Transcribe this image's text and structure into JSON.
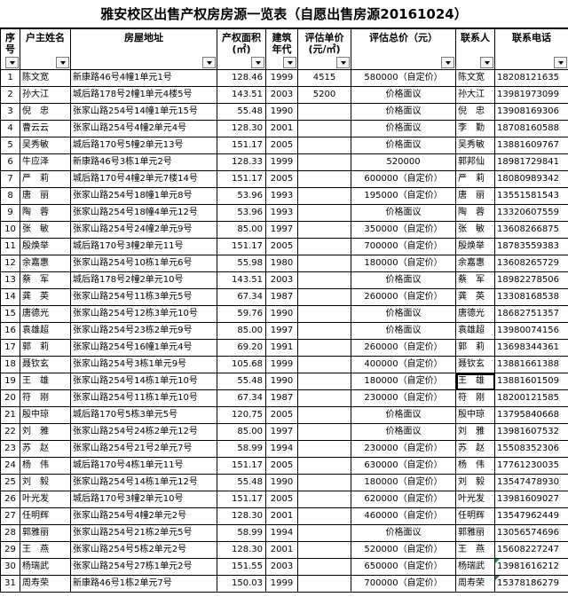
{
  "title": "雅安校区出售产权房房源一览表（自愿出售房源20161024）",
  "headers": [
    {
      "key": "seq",
      "label": "序号"
    },
    {
      "key": "owner",
      "label": "户主姓名"
    },
    {
      "key": "address",
      "label": "房屋地址"
    },
    {
      "key": "area",
      "label": "产权面积(㎡)"
    },
    {
      "key": "year",
      "label": "建筑年代"
    },
    {
      "key": "unit_price",
      "label": "评估单价(元/㎡)"
    },
    {
      "key": "total",
      "label": "评估总价（元）"
    },
    {
      "key": "contact",
      "label": "联系人"
    },
    {
      "key": "phone",
      "label": "联系电话"
    }
  ],
  "rows": [
    {
      "seq": "1",
      "owner": "陈文宽",
      "address": "新康路46号4幢1单元1号",
      "area": "128.46",
      "year": "1999",
      "unit_price": "4515",
      "total": "580000（自定价）",
      "contact": "陈文宽",
      "phone": "18208121635"
    },
    {
      "seq": "2",
      "owner": "孙大江",
      "address": "城后路178号2幢1单元4楼5号",
      "area": "143.51",
      "year": "2003",
      "unit_price": "5200",
      "total": "价格面议",
      "contact": "孙大江",
      "phone": "13981973099"
    },
    {
      "seq": "3",
      "owner": "倪　忠",
      "address": "张家山路254号14幢1单元15号",
      "area": "55.48",
      "year": "1990",
      "unit_price": "",
      "total": "价格面议",
      "contact": "倪　忠",
      "phone": "13908169306"
    },
    {
      "seq": "4",
      "owner": "曹云云",
      "address": "张家山路254号4幢2单元4号",
      "area": "128.30",
      "year": "2001",
      "unit_price": "",
      "total": "价格面议",
      "contact": "李　勤",
      "phone": "18708160588"
    },
    {
      "seq": "5",
      "owner": "吴秀敏",
      "address": "城后路170号5幢2单元13号",
      "area": "151.17",
      "year": "2005",
      "unit_price": "",
      "total": "价格面议",
      "contact": "吴秀敏",
      "phone": "13881609767"
    },
    {
      "seq": "6",
      "owner": "牛应泽",
      "address": "新康路46号3栋1单元2号",
      "area": "128.33",
      "year": "1999",
      "unit_price": "",
      "total": "520000",
      "contact": "郭邦仙",
      "phone": "18981729841"
    },
    {
      "seq": "7",
      "owner": "严　莉",
      "address": "城后路170号4幢2单元7楼14号",
      "area": "151.17",
      "year": "2005",
      "unit_price": "",
      "total": "600000（自定价）",
      "contact": "严　莉",
      "phone": "18080989342"
    },
    {
      "seq": "8",
      "owner": "唐　丽",
      "address": "张家山路254号18幢1单元8号",
      "area": "53.96",
      "year": "1993",
      "unit_price": "",
      "total": "195000（自定价）",
      "contact": "唐　丽",
      "phone": "13551581543"
    },
    {
      "seq": "9",
      "owner": "陶　蓉",
      "address": "张家山路254号18幢4单元12号",
      "area": "53.96",
      "year": "1993",
      "unit_price": "",
      "total": "价格面议",
      "contact": "陶　蓉",
      "phone": "13320607559"
    },
    {
      "seq": "10",
      "owner": "张　敏",
      "address": "张家山路254号24幢2单元9号",
      "area": "85.00",
      "year": "1997",
      "unit_price": "",
      "total": "350000（自定价）",
      "contact": "张　敏",
      "phone": "13608266875"
    },
    {
      "seq": "11",
      "owner": "殷焕举",
      "address": "城后路170号3幢2单元11号",
      "area": "151.17",
      "year": "2005",
      "unit_price": "",
      "total": "700000（自定价）",
      "contact": "殷焕举",
      "phone": "18783559383"
    },
    {
      "seq": "12",
      "owner": "余嘉惠",
      "address": "张家山路254号10栋1单元6号",
      "area": "55.98",
      "year": "1980",
      "unit_price": "",
      "total": "180000（自定价）",
      "contact": "余嘉惠",
      "phone": "13608265729"
    },
    {
      "seq": "13",
      "owner": "蔡　军",
      "address": "城后路178号2幢2单元10号",
      "area": "143.51",
      "year": "2003",
      "unit_price": "",
      "total": "价格面议",
      "contact": "蔡　军",
      "phone": "18982278506"
    },
    {
      "seq": "14",
      "owner": "龚　英",
      "address": "张家山路254号11栋3单元5号",
      "area": "67.34",
      "year": "1987",
      "unit_price": "",
      "total": "260000（自定价）",
      "contact": "龚　英",
      "phone": "13308168538"
    },
    {
      "seq": "15",
      "owner": "唐德光",
      "address": "张家山路254号12栋3单元10号",
      "area": "59.76",
      "year": "1990",
      "unit_price": "",
      "total": "价格面议",
      "contact": "唐德光",
      "phone": "18682751357"
    },
    {
      "seq": "16",
      "owner": "袁雄超",
      "address": "张家山路254号23栋2单元9号",
      "area": "85.00",
      "year": "1997",
      "unit_price": "",
      "total": "价格面议",
      "contact": "袁雄超",
      "phone": "13980074156"
    },
    {
      "seq": "17",
      "owner": "郭　莉",
      "address": "张家山路254号16幢1单元4号",
      "area": "69.20",
      "year": "1991",
      "unit_price": "",
      "total": "260000（自定价）",
      "contact": "郭　莉",
      "phone": "13698344361"
    },
    {
      "seq": "18",
      "owner": "聂钦玄",
      "address": "张家山路254号3栋1单元9号",
      "area": "105.68",
      "year": "1999",
      "unit_price": "",
      "total": "400000（自定价）",
      "contact": "聂钦玄",
      "phone": "13881661388"
    },
    {
      "seq": "19",
      "owner": "王　雄",
      "address": "张家山路254号14栋1单元10号",
      "area": "55.48",
      "year": "1990",
      "unit_price": "",
      "total": "180000（自定价）",
      "contact": "王　雄",
      "phone": "13881601509"
    },
    {
      "seq": "20",
      "owner": "符　刚",
      "address": "张家山路254号11栋1单元10号",
      "area": "67.34",
      "year": "1987",
      "unit_price": "",
      "total": "230000（自定价）",
      "contact": "符　刚",
      "phone": "18200121585"
    },
    {
      "seq": "21",
      "owner": "殷中琼",
      "address": "城后路170号5栋3单元5号",
      "area": "120.75",
      "year": "2005",
      "unit_price": "",
      "total": "价格面议",
      "contact": "殷中琼",
      "phone": "13795840668"
    },
    {
      "seq": "22",
      "owner": "刘　雅",
      "address": "张家山路254号24栋2单元12号",
      "area": "85.00",
      "year": "1997",
      "unit_price": "",
      "total": "价格面议",
      "contact": "刘　雅",
      "phone": "13981607532"
    },
    {
      "seq": "23",
      "owner": "苏　赵",
      "address": "张家山路254号21号2单元7号",
      "area": "58.99",
      "year": "1994",
      "unit_price": "",
      "total": "230000（自定价）",
      "contact": "苏　赵",
      "phone": "15508352306"
    },
    {
      "seq": "24",
      "owner": "杨　伟",
      "address": "城后路170号4栋1单元11号",
      "area": "151.17",
      "year": "2005",
      "unit_price": "",
      "total": "630000（自定价）",
      "contact": "杨　伟",
      "phone": "17761230035"
    },
    {
      "seq": "25",
      "owner": "刘　毅",
      "address": "张家山路254号14栋1单元12号",
      "area": "55.48",
      "year": "1990",
      "unit_price": "",
      "total": "180000（自定价）",
      "contact": "刘　毅",
      "phone": "13547478930"
    },
    {
      "seq": "26",
      "owner": "叶光发",
      "address": "城后路170号3幢2单元10号",
      "area": "151.17",
      "year": "2005",
      "unit_price": "",
      "total": "620000（自定价）",
      "contact": "叶光发",
      "phone": "13981609027"
    },
    {
      "seq": "27",
      "owner": "任明辉",
      "address": "张家山路254号4幢2单元2号",
      "area": "128.30",
      "year": "2001",
      "unit_price": "",
      "total": "460000（自定价）",
      "contact": "任明辉",
      "phone": "13547962449"
    },
    {
      "seq": "28",
      "owner": "郭雅丽",
      "address": "张家山路254号21栋2单元5号",
      "area": "58.99",
      "year": "1994",
      "unit_price": "",
      "total": "价格面议",
      "contact": "郭雅丽",
      "phone": "13056574696"
    },
    {
      "seq": "29",
      "owner": "王　燕",
      "address": "张家山路254号5栋2单元2号",
      "area": "128.30",
      "year": "2001",
      "unit_price": "",
      "total": "520000（自定价）",
      "contact": "王　燕",
      "phone": "15608227247"
    },
    {
      "seq": "30",
      "owner": "杨瑞武",
      "address": "张家山路254号27栋1单元2号",
      "area": "151.55",
      "year": "2003",
      "unit_price": "",
      "total": "650000（自定价）",
      "contact": "杨瑞武",
      "phone": "13981616212"
    },
    {
      "seq": "31",
      "owner": "周寿荣",
      "address": "新康路46号1栋2单元7号",
      "area": "150.03",
      "year": "1999",
      "unit_price": "",
      "total": "700000（自定价）",
      "contact": "周寿荣",
      "phone": "15378186279"
    }
  ],
  "colors": {
    "border": "#000000",
    "comment_marker": "#1d8f3a",
    "filter_button": "#f4f4f4"
  }
}
